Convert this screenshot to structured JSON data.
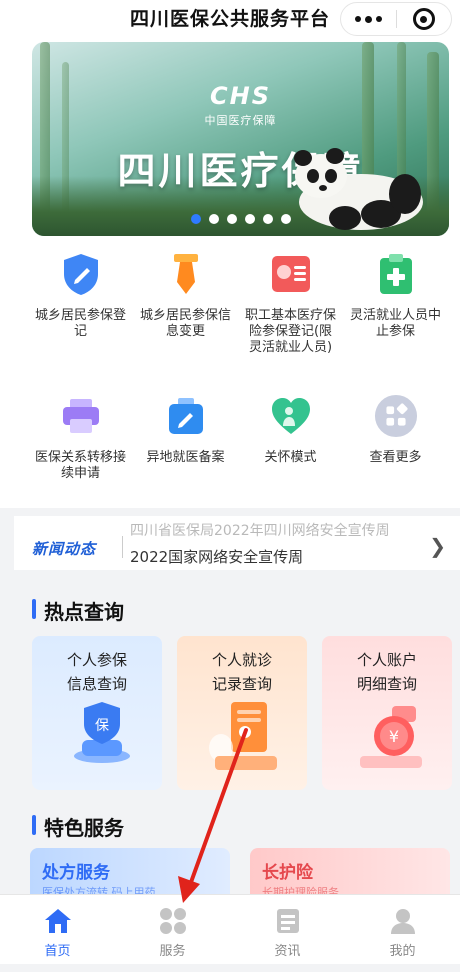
{
  "header": {
    "title": "四川医保公共服务平台"
  },
  "banner": {
    "logo": "CHS",
    "logo_sub": "中国医疗保障",
    "title": "四川医疗保障",
    "active_dot": 0
  },
  "services": [
    {
      "label": "城乡居民参保登记"
    },
    {
      "label": "城乡居民参保信息变更"
    },
    {
      "label": "职工基本医疗保险参保登记(限灵活就业人员)"
    },
    {
      "label": "灵活就业人员中止参保"
    },
    {
      "label": "医保关系转移接续申请"
    },
    {
      "label": "异地就医备案"
    },
    {
      "label": "关怀模式"
    },
    {
      "label": "查看更多"
    }
  ],
  "news": {
    "badge": "新闻动态",
    "prev": "四川省医保局2022年四川网络安全宣传周",
    "current": "2022国家网络安全宣传周"
  },
  "hot": {
    "title": "热点查询",
    "cards": [
      {
        "line1": "个人参保",
        "line2": "信息查询"
      },
      {
        "line1": "个人就诊",
        "line2": "记录查询"
      },
      {
        "line1": "个人账户",
        "line2": "明细查询"
      }
    ]
  },
  "features": {
    "title": "特色服务",
    "items": [
      {
        "title": "处方服务",
        "sub": "医保处方流转 码上用药"
      },
      {
        "title": "长护险",
        "sub": "长期护理险服务"
      }
    ]
  },
  "tabs": [
    {
      "label": "首页"
    },
    {
      "label": "服务"
    },
    {
      "label": "资讯"
    },
    {
      "label": "我的"
    }
  ],
  "colors": {
    "primary": "#2f6cf5",
    "annotation": "#e0231b"
  }
}
